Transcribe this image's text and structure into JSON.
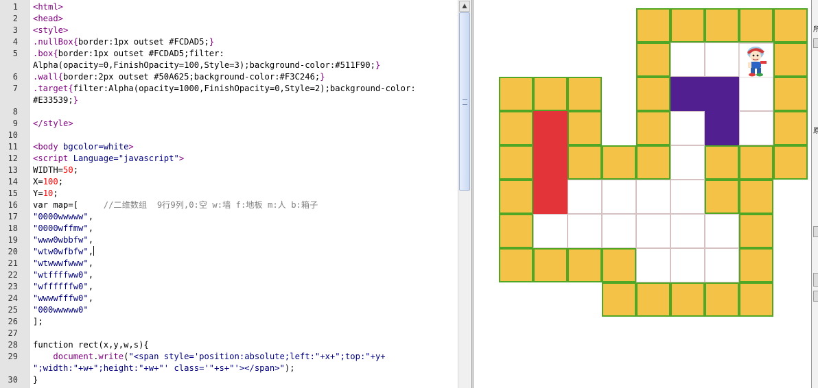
{
  "editor": {
    "lines": [
      {
        "n": "1",
        "segs": [
          {
            "c": "tag",
            "t": "<html>"
          }
        ]
      },
      {
        "n": "2",
        "segs": [
          {
            "c": "tag",
            "t": "<head>"
          }
        ]
      },
      {
        "n": "3",
        "segs": [
          {
            "c": "tag",
            "t": "<style>"
          }
        ]
      },
      {
        "n": "4",
        "segs": [
          {
            "c": "css",
            "t": ".nullBox{"
          },
          {
            "c": "",
            "t": "border:1px outset #FCDAD5;"
          },
          {
            "c": "css",
            "t": "}"
          }
        ]
      },
      {
        "n": "5",
        "wrap": true,
        "segs": [
          {
            "c": "css",
            "t": ".box{"
          },
          {
            "c": "",
            "t": "border:1px outset #FCDAD5;filter: Alpha(opacity=0,FinishOpacity=100,Style=3);background-color:#511F90;"
          },
          {
            "c": "css",
            "t": "}"
          }
        ]
      },
      {
        "n": "6",
        "segs": [
          {
            "c": "css",
            "t": ".wall{"
          },
          {
            "c": "",
            "t": "border:2px outset #50A625;background-color:#F3C246;"
          },
          {
            "c": "css",
            "t": "}"
          }
        ]
      },
      {
        "n": "7",
        "wrap": true,
        "segs": [
          {
            "c": "css",
            "t": ".target{"
          },
          {
            "c": "",
            "t": "filter:Alpha(opacity=1000,FinishOpacity=0,Style=2);background-color: #E33539;"
          },
          {
            "c": "css",
            "t": "}"
          }
        ]
      },
      {
        "n": "8",
        "segs": []
      },
      {
        "n": "9",
        "segs": [
          {
            "c": "tag",
            "t": "</style>"
          }
        ]
      },
      {
        "n": "10",
        "segs": []
      },
      {
        "n": "11",
        "segs": [
          {
            "c": "tag",
            "t": "<body"
          },
          {
            "c": "str",
            "t": " bgcolor=white"
          },
          {
            "c": "tag",
            "t": ">"
          }
        ]
      },
      {
        "n": "12",
        "segs": [
          {
            "c": "tag",
            "t": "<script"
          },
          {
            "c": "str",
            "t": " Language=\"javascript\""
          },
          {
            "c": "tag",
            "t": ">"
          }
        ]
      },
      {
        "n": "13",
        "segs": [
          {
            "c": "",
            "t": "WIDTH="
          },
          {
            "c": "num",
            "t": "50"
          },
          {
            "c": "",
            "t": ";"
          }
        ]
      },
      {
        "n": "14",
        "segs": [
          {
            "c": "",
            "t": "X="
          },
          {
            "c": "num",
            "t": "100"
          },
          {
            "c": "",
            "t": ";"
          }
        ]
      },
      {
        "n": "15",
        "segs": [
          {
            "c": "",
            "t": "Y="
          },
          {
            "c": "num",
            "t": "10"
          },
          {
            "c": "",
            "t": ";"
          }
        ]
      },
      {
        "n": "16",
        "segs": [
          {
            "c": "",
            "t": "var map=["
          },
          {
            "c": "cmt",
            "t": "     //二维数组  9行9列,0:空 w:墙 f:地板 m:人 b:箱子"
          }
        ]
      },
      {
        "n": "17",
        "segs": [
          {
            "c": "str",
            "t": "\"0000wwwww\""
          },
          {
            "c": "",
            "t": ","
          }
        ]
      },
      {
        "n": "18",
        "segs": [
          {
            "c": "str",
            "t": "\"0000wffmw\""
          },
          {
            "c": "",
            "t": ","
          }
        ]
      },
      {
        "n": "19",
        "segs": [
          {
            "c": "str",
            "t": "\"www0wbbfw\""
          },
          {
            "c": "",
            "t": ","
          }
        ]
      },
      {
        "n": "20",
        "caret": true,
        "segs": [
          {
            "c": "str",
            "t": "\"wtw0wfbfw\""
          },
          {
            "c": "",
            "t": ","
          }
        ]
      },
      {
        "n": "21",
        "segs": [
          {
            "c": "str",
            "t": "\"wtwwwfwww\""
          },
          {
            "c": "",
            "t": ","
          }
        ]
      },
      {
        "n": "22",
        "segs": [
          {
            "c": "str",
            "t": "\"wtffffww0\""
          },
          {
            "c": "",
            "t": ","
          }
        ]
      },
      {
        "n": "23",
        "segs": [
          {
            "c": "str",
            "t": "\"wffffffw0\""
          },
          {
            "c": "",
            "t": ","
          }
        ]
      },
      {
        "n": "24",
        "segs": [
          {
            "c": "str",
            "t": "\"wwwwfffw0\""
          },
          {
            "c": "",
            "t": ","
          }
        ]
      },
      {
        "n": "25",
        "segs": [
          {
            "c": "str",
            "t": "\"000wwwww0\""
          }
        ]
      },
      {
        "n": "26",
        "segs": [
          {
            "c": "",
            "t": "];"
          }
        ]
      },
      {
        "n": "27",
        "segs": []
      },
      {
        "n": "28",
        "segs": [
          {
            "c": "",
            "t": "function rect(x,y,w,s){"
          }
        ]
      },
      {
        "n": "29",
        "wrap": true,
        "segs": [
          {
            "c": "",
            "t": "    "
          },
          {
            "c": "css",
            "t": "document"
          },
          {
            "c": "",
            "t": "."
          },
          {
            "c": "css",
            "t": "write"
          },
          {
            "c": "",
            "t": "("
          },
          {
            "c": "str",
            "t": "\"<span style='position:absolute;left:\"+x+\";top:\"+y+ \";width:\"+w+\";height:\"+w+\"' class='\"+s+\"'></span>\""
          },
          {
            "c": "",
            "t": ");"
          }
        ]
      },
      {
        "n": "30",
        "segs": [
          {
            "c": "",
            "t": "}"
          }
        ]
      }
    ],
    "scroll_up_glyph": "▲"
  },
  "game": {
    "map": [
      "0000wwwww",
      "0000wffmw",
      "www0wbbfw",
      "wtw0wfbfw",
      "wtwwwfwww",
      "wtffffww0",
      "wffffffw0",
      "wwwwfffw0",
      "000wwwww0"
    ],
    "colors": {
      "wall": "#F3C246",
      "wall_border": "#50A625",
      "box": "#511F90",
      "target": "#E33539",
      "floor_border": "#d6c2c2"
    },
    "character_icon": "boy-character-icon"
  },
  "right_panel": {
    "glyphs": [
      "所",
      "原"
    ]
  }
}
